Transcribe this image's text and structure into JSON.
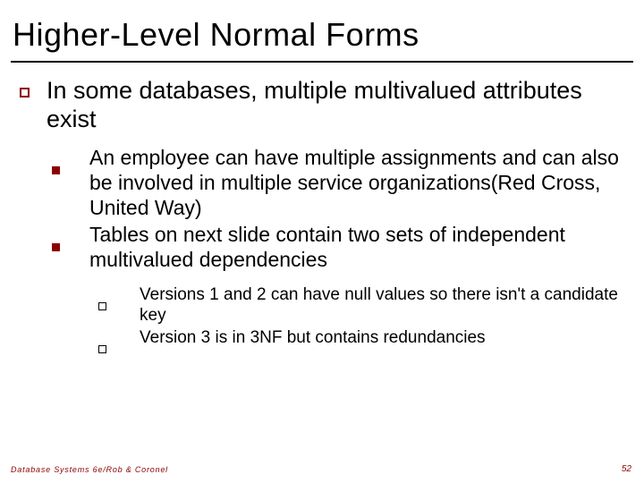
{
  "title": "Higher-Level Normal Forms",
  "bullets": {
    "lvl1": "In some databases, multiple multivalued attributes exist",
    "lvl2a": "An employee can have multiple assignments and can also be involved in multiple service organizations(Red Cross, United Way)",
    "lvl2b": "Tables on next slide contain two sets of independent multivalued dependencies",
    "lvl3a": "Versions 1 and 2 can have null values so there isn't a candidate key",
    "lvl3b": "Version 3 is in 3NF but contains redundancies"
  },
  "footer": {
    "left": "Database Systems 6e/Rob & Coronel",
    "right": "52"
  }
}
